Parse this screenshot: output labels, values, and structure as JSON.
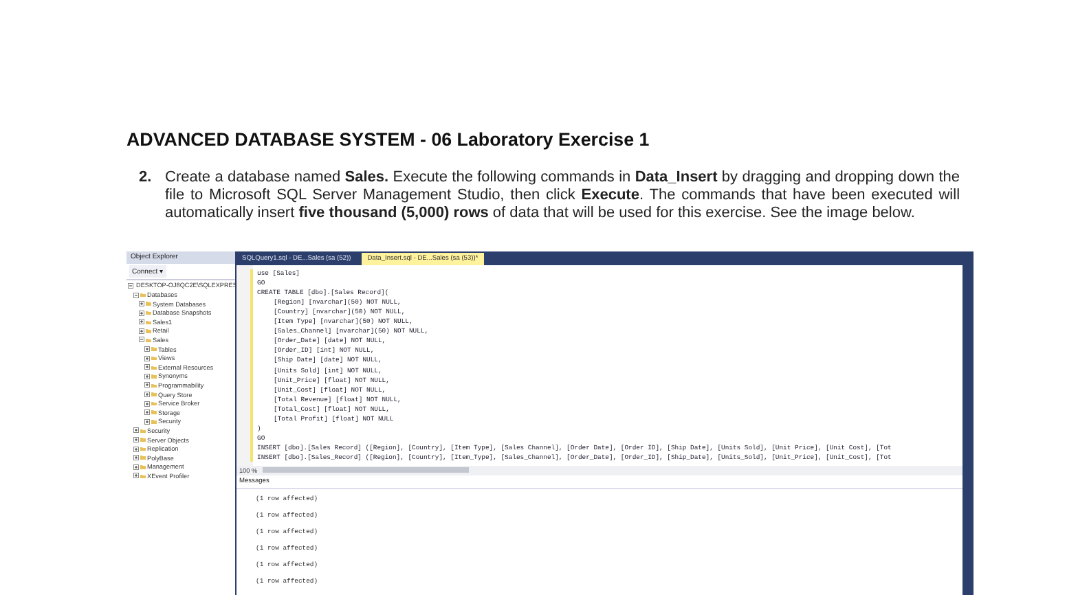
{
  "heading": "ADVANCED DATABASE SYSTEM - 06 Laboratory Exercise 1",
  "instruction": {
    "number": "2.",
    "text": "Create a database named **Sales.** Execute the following commands in **Data_Insert** by dragging and dropping down the file to Microsoft SQL Server Management Studio, then click **Execute**. The commands that have been executed will automatically insert **five thousand (5,000) rows** of data that will be used for this exercise. See the image below."
  },
  "screenshot": {
    "object_explorer": {
      "title": "Object Explorer",
      "connect": "Connect ▾",
      "tree": [
        {
          "label": "DESKTOP-OJ8QC2E\\SQLEXPRES",
          "expanded": true,
          "children": [
            {
              "label": "Databases",
              "expanded": true,
              "children": [
                {
                  "label": "System Databases",
                  "expanded": false
                },
                {
                  "label": "Database Snapshots",
                  "expanded": false
                },
                {
                  "label": "Sales1",
                  "expanded": false
                },
                {
                  "label": "Retail",
                  "expanded": false
                },
                {
                  "label": "Sales",
                  "expanded": true,
                  "children": [
                    {
                      "label": "Tables",
                      "expanded": false
                    },
                    {
                      "label": "Views",
                      "expanded": false
                    },
                    {
                      "label": "External Resources",
                      "expanded": false
                    },
                    {
                      "label": "Synonyms",
                      "expanded": false
                    },
                    {
                      "label": "Programmability",
                      "expanded": false
                    },
                    {
                      "label": "Query Store",
                      "expanded": false
                    },
                    {
                      "label": "Service Broker",
                      "expanded": false
                    },
                    {
                      "label": "Storage",
                      "expanded": false
                    },
                    {
                      "label": "Security",
                      "expanded": false
                    }
                  ]
                }
              ]
            },
            {
              "label": "Security",
              "expanded": false
            },
            {
              "label": "Server Objects",
              "expanded": false
            },
            {
              "label": "Replication",
              "expanded": false
            },
            {
              "label": "PolyBase",
              "expanded": false
            },
            {
              "label": "Management",
              "expanded": false
            },
            {
              "label": "XEvent Profiler",
              "expanded": false
            }
          ]
        }
      ]
    },
    "tabs": [
      {
        "label": "SQLQuery1.sql - DE...Sales (sa (52))",
        "selected": false
      },
      {
        "label": "Data_Insert.sql - DE...Sales (sa (53))*",
        "selected": true
      }
    ],
    "code_lines": [
      {
        "text": "use [Sales]",
        "indent": false
      },
      {
        "text": "GO",
        "indent": false
      },
      {
        "text": "CREATE TABLE [dbo].[Sales Record](",
        "indent": false
      },
      {
        "text": "[Region] [nvarchar](50) NOT NULL,",
        "indent": true
      },
      {
        "text": "[Country] [nvarchar](50) NOT NULL,",
        "indent": true
      },
      {
        "text": "[Item Type] [nvarchar](50) NOT NULL,",
        "indent": true
      },
      {
        "text": "[Sales_Channel] [nvarchar](50) NOT NULL,",
        "indent": true
      },
      {
        "text": "[Order_Date] [date] NOT NULL,",
        "indent": true
      },
      {
        "text": "[Order_ID] [int] NOT NULL,",
        "indent": true
      },
      {
        "text": "[Ship Date] [date] NOT NULL,",
        "indent": true
      },
      {
        "text": "[Units Sold] [int] NOT NULL,",
        "indent": true
      },
      {
        "text": "[Unit_Price] [float] NOT NULL,",
        "indent": true
      },
      {
        "text": "[Unit_Cost] [float] NOT NULL,",
        "indent": true
      },
      {
        "text": "[Total Revenue] [float] NOT NULL,",
        "indent": true
      },
      {
        "text": "[Total_Cost] [float] NOT NULL,",
        "indent": true
      },
      {
        "text": "[Total Profit] [float] NOT NULL",
        "indent": true
      },
      {
        "text": ")",
        "indent": false
      },
      {
        "text": "GO",
        "indent": false
      },
      {
        "text": "INSERT [dbo].[Sales Record] ([Region], [Country], [Item Type], [Sales Channel], [Order Date], [Order ID], [Ship Date], [Units Sold], [Unit Price], [Unit Cost], [Tot",
        "indent": false
      },
      {
        "text": "INSERT [dbo].[Sales_Record] ([Region], [Country], [Item_Type], [Sales_Channel], [Order_Date], [Order_ID], [Ship_Date], [Units_Sold], [Unit_Price], [Unit_Cost], [Tot",
        "indent": false
      }
    ],
    "zoom": "100 %",
    "results_tab": "Messages",
    "messages": [
      "(1 row affected)",
      "(1 row affected)",
      "(1 row affected)",
      "(1 row affected)",
      "(1 row affected)",
      "(1 row affected)"
    ]
  }
}
